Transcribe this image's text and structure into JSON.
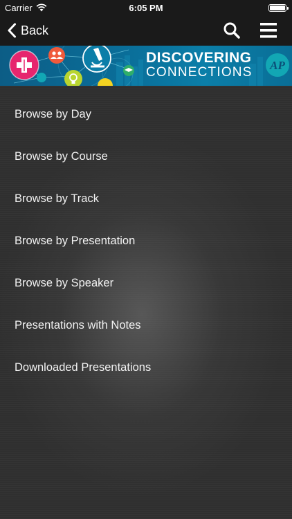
{
  "status_bar": {
    "carrier": "Carrier",
    "time": "6:05 PM",
    "battery_level": 1.0
  },
  "nav": {
    "back_label": "Back",
    "search_icon": "search-icon",
    "menu_icon": "hamburger-menu-icon"
  },
  "banner": {
    "title": "DISCOVERING",
    "subtitle": "CONNECTIONS",
    "logo_letters": "AP",
    "colors": {
      "background": "#0a6f9a",
      "pink": "#e6266e",
      "orange": "#f05a3c",
      "lime": "#b9d530",
      "teal": "#12a7b4",
      "yellow": "#f4d321",
      "green": "#2fae6a"
    }
  },
  "menu": {
    "items": [
      {
        "label": "Browse by Day"
      },
      {
        "label": "Browse by Course"
      },
      {
        "label": "Browse by Track"
      },
      {
        "label": "Browse by Presentation"
      },
      {
        "label": "Browse by Speaker"
      },
      {
        "label": "Presentations with Notes"
      },
      {
        "label": "Downloaded Presentations"
      }
    ]
  }
}
